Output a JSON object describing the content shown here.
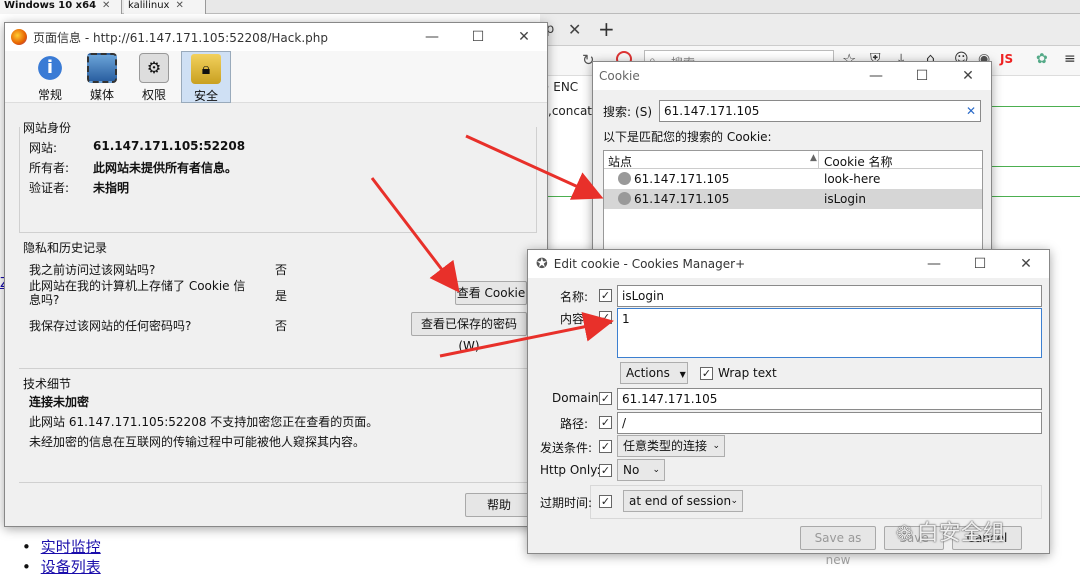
{
  "vm_tabs": [
    {
      "label": "Windows 10 x64"
    },
    {
      "label": "kalilinux"
    }
  ],
  "bg_browser": {
    "tab_fragment": "p",
    "search_placeholder": "搜索",
    "text_fragments": [
      ",concat(",
      "S· ENC"
    ],
    "side_letter": "Z",
    "links": [
      "实时监控",
      "设备列表"
    ]
  },
  "page_info": {
    "title": "页面信息 - http://61.147.171.105:52208/Hack.php",
    "toolbar": [
      {
        "label": "常规",
        "icon": "info-icon"
      },
      {
        "label": "媒体",
        "icon": "media-icon"
      },
      {
        "label": "权限",
        "icon": "permissions-icon"
      },
      {
        "label": "安全",
        "icon": "lock-icon",
        "active": true
      }
    ],
    "identity": {
      "heading": "网站身份",
      "website_label": "网站:",
      "website_value": "61.147.171.105:52208",
      "owner_label": "所有者:",
      "owner_value": "此网站未提供所有者信息。",
      "verifier_label": "验证者:",
      "verifier_value": "未指明"
    },
    "privacy": {
      "heading": "隐私和历史记录",
      "q1": "我之前访问过该网站吗?",
      "a1": "否",
      "q2": "此网站在我的计算机上存储了 Cookie 信息吗?",
      "a2": "是",
      "q3": "我保存过该网站的任何密码吗?",
      "a3": "否",
      "view_cookie_btn": "查看 Cookie",
      "view_password_btn": "查看已保存的密码(W)"
    },
    "tech": {
      "heading": "技术细节",
      "status": "连接未加密",
      "line1": "此网站 61.147.171.105:52208 不支持加密您正在查看的页面。",
      "line2": "未经加密的信息在互联网的传输过程中可能被他人窥探其内容。"
    },
    "help_btn": "帮助"
  },
  "cookie_window": {
    "title": "Cookie",
    "search_label": "搜索:",
    "search_shortcut": "(S)",
    "search_value": "61.147.171.105",
    "match_text": "以下是匹配您的搜索的 Cookie:",
    "col_site": "站点",
    "col_name": "Cookie 名称",
    "rows": [
      {
        "site": "61.147.171.105",
        "name": "look-here"
      },
      {
        "site": "61.147.171.105",
        "name": "isLogin",
        "selected": true
      }
    ]
  },
  "edit_cookie": {
    "title": "Edit cookie - Cookies Manager+",
    "name_label": "名称:",
    "name_value": "isLogin",
    "content_label": "内容:",
    "content_value": "1",
    "actions_btn": "Actions",
    "wrap_text": "Wrap text",
    "domain_label": "Domain:",
    "domain_value": "61.147.171.105",
    "path_label": "路径:",
    "path_value": "/",
    "send_label": "发送条件:",
    "send_value": "任意类型的连接",
    "httponly_label": "Http Only:",
    "httponly_value": "No",
    "expire_label": "过期时间:",
    "expire_value": "at end of session",
    "save_as_new_btn": "Save as new",
    "save_btn": "Save",
    "cancel_btn": "Cancel"
  },
  "watermark": "白安全组",
  "colors": {
    "arrow": "#e8302a",
    "selected_row": "#d6d6d6",
    "link": "#1a0dab"
  }
}
